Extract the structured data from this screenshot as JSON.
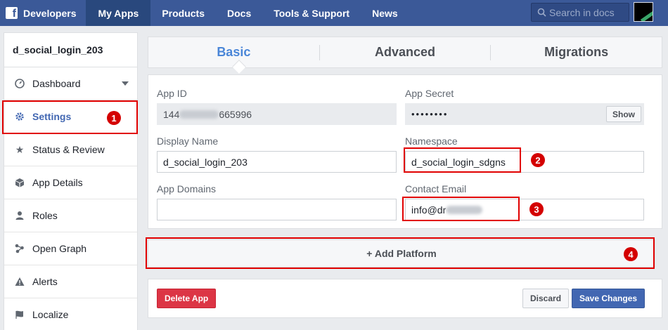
{
  "topnav": {
    "brand": "Developers",
    "items": [
      "My Apps",
      "Products",
      "Docs",
      "Tools & Support",
      "News"
    ],
    "active": "My Apps",
    "search_placeholder": "Search in docs"
  },
  "sidebar": {
    "app_name": "d_social_login_203",
    "items": [
      {
        "label": "Dashboard",
        "icon": "dashboard-icon"
      },
      {
        "label": "Settings",
        "icon": "gear-icon"
      },
      {
        "label": "Status & Review",
        "icon": "star-icon"
      },
      {
        "label": "App Details",
        "icon": "cube-icon"
      },
      {
        "label": "Roles",
        "icon": "person-icon"
      },
      {
        "label": "Open Graph",
        "icon": "graph-icon"
      },
      {
        "label": "Alerts",
        "icon": "warning-icon"
      },
      {
        "label": "Localize",
        "icon": "flag-icon"
      }
    ],
    "active": "Settings"
  },
  "tabs": [
    "Basic",
    "Advanced",
    "Migrations"
  ],
  "active_tab": "Basic",
  "form": {
    "app_id_label": "App ID",
    "app_id_prefix": "144",
    "app_id_suffix": "665996",
    "app_secret_label": "App Secret",
    "app_secret_value": "••••••••",
    "show_label": "Show",
    "display_name_label": "Display Name",
    "display_name_value": "d_social_login_203",
    "namespace_label": "Namespace",
    "namespace_value": "d_social_login_sdgns",
    "app_domains_label": "App Domains",
    "app_domains_value": "",
    "contact_email_label": "Contact Email",
    "contact_email_value": "info@dr"
  },
  "add_platform_label": "+ Add Platform",
  "buttons": {
    "delete": "Delete App",
    "discard": "Discard",
    "save": "Save Changes"
  },
  "annotations": [
    "1",
    "2",
    "3",
    "4"
  ],
  "colors": {
    "nav": "#3b5998",
    "accent": "#4267b2",
    "annotation": "#e10000",
    "delete": "#dc3545"
  }
}
